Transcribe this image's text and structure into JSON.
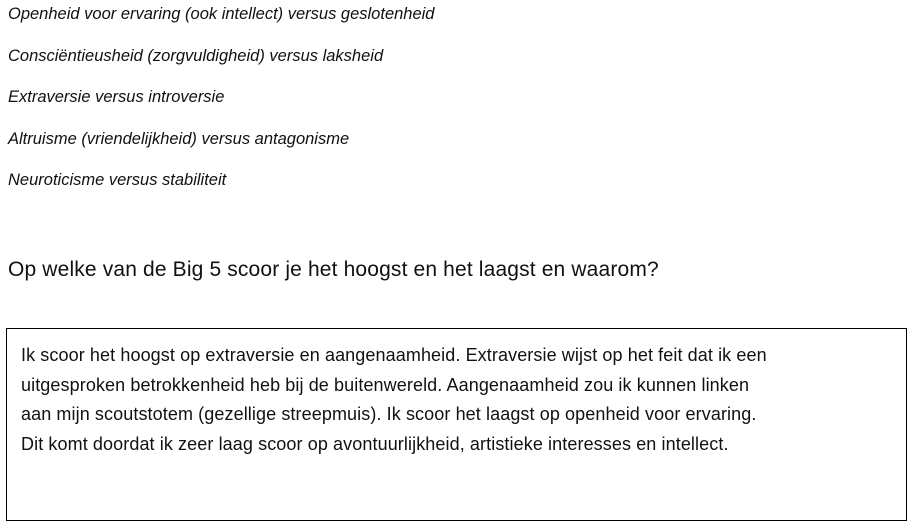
{
  "traits": [
    "Openheid voor ervaring (ook intellect) versus geslotenheid",
    "Consciëntieusheid (zorgvuldigheid) versus laksheid",
    "Extraversie versus introversie",
    "Altruisme (vriendelijkheid) versus antagonisme",
    "Neuroticisme versus stabiliteit"
  ],
  "question": "Op welke van de Big 5 scoor je het hoogst en het laagst en waarom?",
  "answer": {
    "lines": [
      "Ik scoor het hoogst op extraversie en aangenaamheid. Extraversie wijst op het feit dat ik een",
      "uitgesproken betrokkenheid heb bij de buitenwereld. Aangenaamheid zou ik kunnen linken",
      "aan mijn scoutstotem (gezellige streepmuis). Ik scoor het laagst op openheid voor ervaring.",
      "Dit komt doordat ik zeer laag scoor op avontuurlijkheid, artistieke interesses en intellect."
    ]
  }
}
